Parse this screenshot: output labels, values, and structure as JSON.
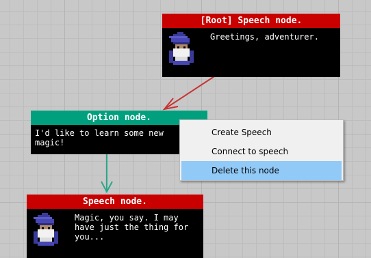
{
  "nodes": {
    "root": {
      "title": "[Root] Speech node.",
      "text": "Greetings, adventurer.",
      "portrait": "wizard-portrait-icon"
    },
    "option": {
      "title": "Option node.",
      "text": "I'd like to learn some new\nmagic!"
    },
    "speech2": {
      "title": "Speech node.",
      "text": "Magic, you say. I may\nhave just the thing for\nyou...",
      "portrait": "wizard-portrait-icon"
    }
  },
  "context_menu": {
    "items": [
      {
        "label": "Create Speech",
        "selected": false
      },
      {
        "label": "Connect to speech",
        "selected": false
      },
      {
        "label": "Delete this node",
        "selected": true
      }
    ]
  },
  "colors": {
    "speech_header": "#c80000",
    "option_header": "#00a07e",
    "link_speech_to_option": "#c83232",
    "link_option_to_speech": "#2aa88a",
    "menu_highlight": "#91c9f7",
    "grid_background": "#c8c8c8"
  }
}
